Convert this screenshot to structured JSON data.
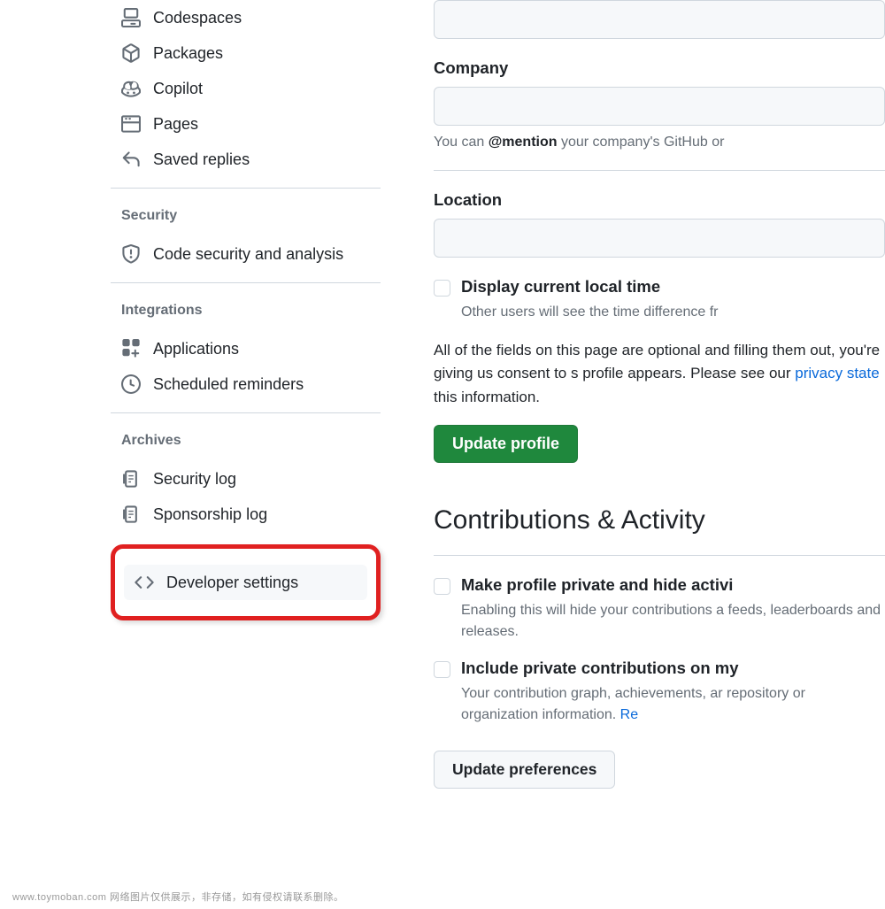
{
  "sidebar": {
    "items_top": [
      {
        "label": "Codespaces",
        "icon": "codespaces-icon"
      },
      {
        "label": "Packages",
        "icon": "package-icon"
      },
      {
        "label": "Copilot",
        "icon": "copilot-icon"
      },
      {
        "label": "Pages",
        "icon": "browser-icon"
      },
      {
        "label": "Saved replies",
        "icon": "reply-icon"
      }
    ],
    "security": {
      "header": "Security",
      "items": [
        {
          "label": "Code security and analysis",
          "icon": "shield-icon"
        }
      ]
    },
    "integrations": {
      "header": "Integrations",
      "items": [
        {
          "label": "Applications",
          "icon": "apps-icon"
        },
        {
          "label": "Scheduled reminders",
          "icon": "clock-icon"
        }
      ]
    },
    "archives": {
      "header": "Archives",
      "items": [
        {
          "label": "Security log",
          "icon": "log-icon"
        },
        {
          "label": "Sponsorship log",
          "icon": "log-icon"
        }
      ]
    },
    "developer_settings": {
      "label": "Developer settings",
      "icon": "code-icon"
    }
  },
  "profile": {
    "company": {
      "label": "Company",
      "hint_pre": "You can ",
      "hint_bold": "@mention",
      "hint_post": " your company's GitHub or"
    },
    "location": {
      "label": "Location"
    },
    "local_time": {
      "label": "Display current local time",
      "desc": "Other users will see the time difference fr"
    },
    "disclosure_pre": "All of the fields on this page are optional and filling them out, you're giving us consent to s profile appears. Please see our ",
    "disclosure_link": "privacy state",
    "disclosure_post": " this information.",
    "update_button": "Update profile"
  },
  "contrib": {
    "heading": "Contributions & Activity",
    "private_profile": {
      "label": "Make profile private and hide activi",
      "desc": "Enabling this will hide your contributions a feeds, leaderboards and releases."
    },
    "include_private": {
      "label": "Include private contributions on my",
      "desc_pre": "Your contribution graph, achievements, ar repository or organization information. ",
      "desc_link": "Re"
    },
    "update_button": "Update preferences"
  },
  "footer": "www.toymoban.com 网络图片仅供展示，非存储，如有侵权请联系删除。"
}
